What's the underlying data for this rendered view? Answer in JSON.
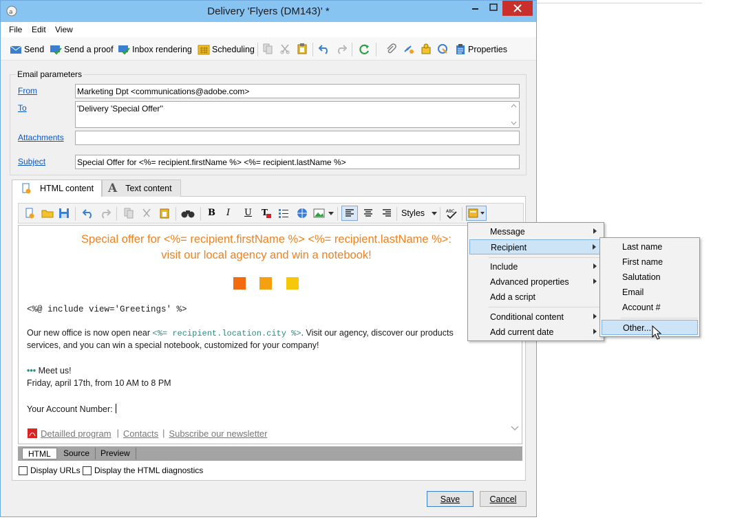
{
  "window": {
    "title": "Delivery 'Flyers (DM143)' *"
  },
  "menubar": [
    "File",
    "Edit",
    "View"
  ],
  "toolbar": {
    "send": "Send",
    "send_proof": "Send a proof",
    "inbox_rendering": "Inbox rendering",
    "scheduling": "Scheduling",
    "properties": "Properties"
  },
  "params": {
    "legend": "Email parameters",
    "from_label": "From",
    "from_value": "Marketing Dpt <communications@adobe.com>",
    "to_label": "To",
    "to_value": "'Delivery 'Special Offer''",
    "attachments_label": "Attachments",
    "attachments_value": "",
    "subject_label": "Subject",
    "subject_value": "Special Offer for <%= recipient.firstName %> <%= recipient.lastName %>"
  },
  "tabs": {
    "html": "HTML content",
    "text": "Text content"
  },
  "editor_toolbar": {
    "styles": "Styles"
  },
  "content": {
    "heading_line1": "Special offer for <%= recipient.firstName %> <%= recipient.lastName %>:",
    "heading_line2": "visit our local agency and win a notebook!",
    "squares": [
      "#f26b0f",
      "#f5a00f",
      "#f7c80a"
    ],
    "include_line": "<%@ include view='Greetings' %>",
    "para1_a": "Our new office is now open near ",
    "para1_code": "<%= recipient.location.city %>",
    "para1_b": ". Visit our agency, discover our products",
    "para1_line2": "services, and you can win a special notebook, customized for your company!",
    "meet_dots": "•••",
    "meet": "Meet us!",
    "date": "Friday, april 17th, from 10 AM to 8 PM",
    "account": "Your Account Number:",
    "links": [
      "Detailled program",
      "Contacts",
      "Subscribe our newsletter"
    ],
    "link_sep": "|"
  },
  "editor_tabs": [
    "HTML",
    "Source",
    "Preview"
  ],
  "options": {
    "display_urls": "Display URLs",
    "display_diag": "Display the HTML diagnostics"
  },
  "buttons": {
    "save": "Save",
    "cancel": "Cancel"
  },
  "menu1": {
    "items": [
      "Message",
      "Recipient",
      "Include",
      "Advanced properties",
      "Add a script",
      "Conditional content",
      "Add current date"
    ]
  },
  "menu2": {
    "items": [
      "Last name",
      "First name",
      "Salutation",
      "Email",
      "Account #",
      "Other..."
    ]
  },
  "colors": {
    "titlebar": "#88c4f2",
    "accent_orange": "#ef8121",
    "link_blue": "#0b56c7",
    "menu_highlight": "#cde4f7"
  }
}
